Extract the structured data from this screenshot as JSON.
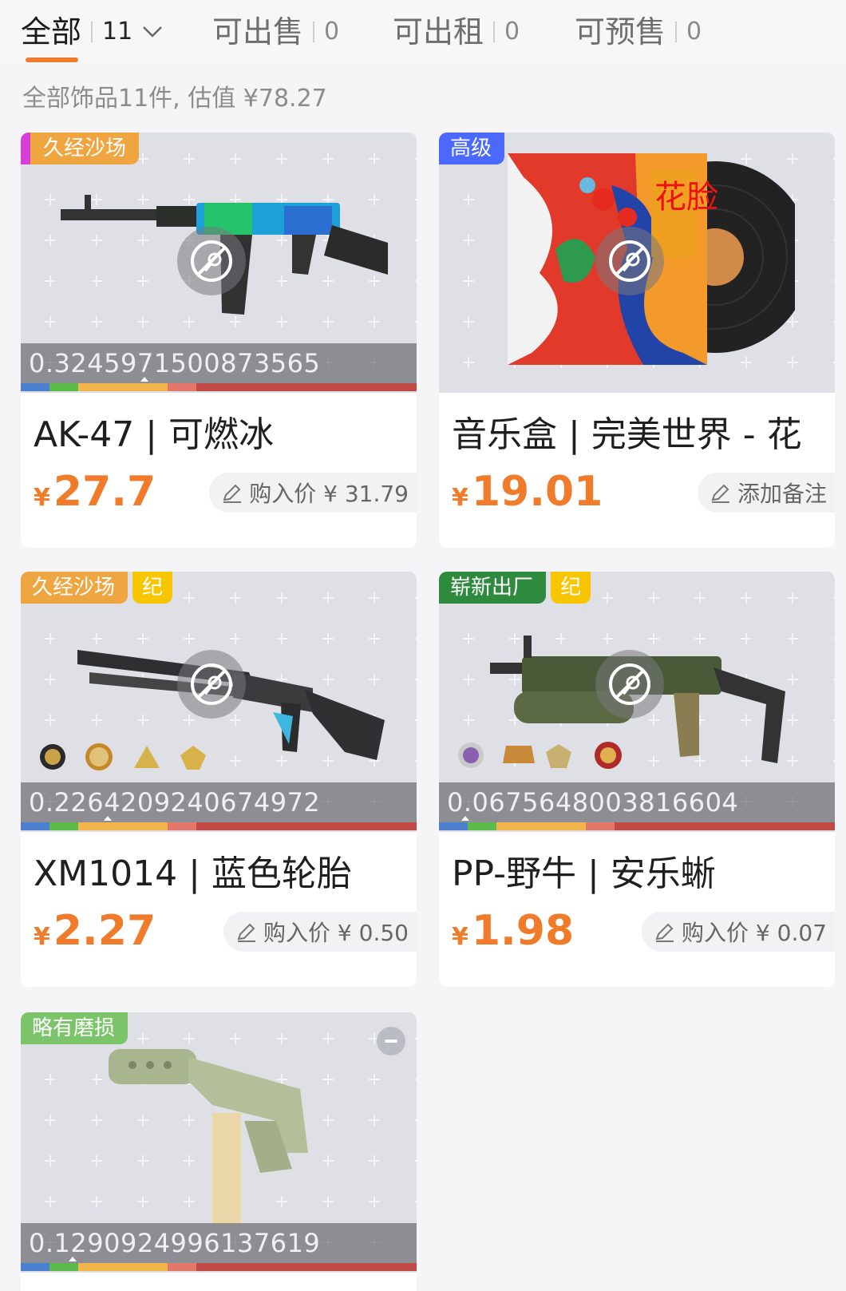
{
  "tabs": [
    {
      "label": "全部",
      "count": "11"
    },
    {
      "label": "可出售",
      "count": "0"
    },
    {
      "label": "可出租",
      "count": "0"
    },
    {
      "label": "可预售",
      "count": "0"
    }
  ],
  "summary": "全部饰品11件, 估值 ¥78.27",
  "currency_symbol": "¥",
  "items": [
    {
      "tags": [
        "久经沙场"
      ],
      "float": "0.3245971500873565",
      "name": "AK-47 | 可燃冰",
      "price": "27.7",
      "pill": "购入价 ¥ 31.79"
    },
    {
      "tags": [
        "高级"
      ],
      "float": "",
      "name": "音乐盒 | 完美世界 - 花",
      "price": "19.01",
      "pill": "添加备注",
      "art_text": "花脸"
    },
    {
      "tags": [
        "久经沙场",
        "纪"
      ],
      "float": "0.2264209240674972",
      "name": "XM1014 | 蓝色轮胎",
      "price": "2.27",
      "pill": "购入价 ¥ 0.50"
    },
    {
      "tags": [
        "崭新出厂",
        "纪"
      ],
      "float": "0.0675648003816604",
      "name": "PP-野牛 | 安乐蜥",
      "price": "1.98",
      "pill": "购入价 ¥ 0.07"
    },
    {
      "tags": [
        "略有磨损"
      ],
      "float": "0.1290924996137619",
      "name": "",
      "price": "",
      "pill": ""
    }
  ],
  "colors": {
    "accent": "#f07c2b",
    "tag_field_tested": "#f0a640",
    "tag_high_grade": "#4b69ff",
    "tag_factory_new": "#2e8b3e",
    "tag_minimal_wear": "#7cc46a",
    "tag_souvenir": "#f7c600",
    "wear_blue": "#4d7fd1",
    "wear_green": "#5cba4a",
    "wear_yellow": "#f2b54c",
    "wear_orange": "#f08c55",
    "wear_red": "#c14a46"
  }
}
